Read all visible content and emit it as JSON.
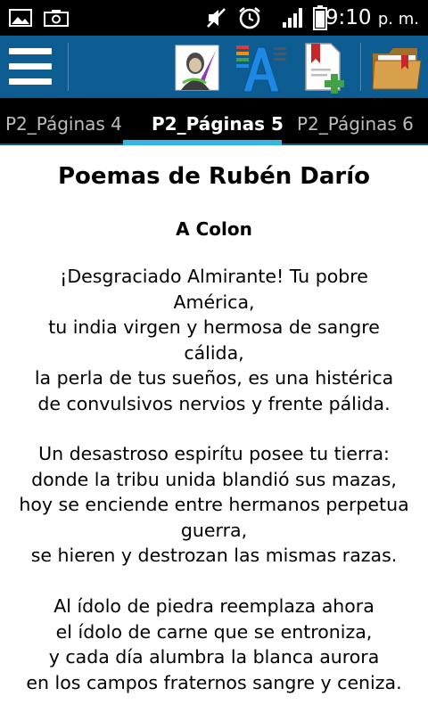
{
  "status_bar": {
    "time": "9:10",
    "ampm": "p. m.",
    "icons": [
      "image-icon",
      "camera-icon",
      "mute-icon",
      "alarm-icon",
      "signal-icon",
      "battery-icon"
    ]
  },
  "toolbar": {
    "icons": [
      "menu-icon",
      "poet-portrait-icon",
      "font-size-icon",
      "add-bookmark-icon",
      "bookmarks-folder-icon"
    ]
  },
  "tabs": [
    {
      "label": "P2_Páginas 4"
    },
    {
      "label": "P2_Páginas 5"
    },
    {
      "label": "P2_Páginas 6"
    }
  ],
  "colors": {
    "toolbar": "#0d5d93",
    "indicator": "#33b5e5",
    "tabbar": "#000000"
  },
  "content": {
    "title": "Poemas de Rubén Darío",
    "subtitle": "A Colon",
    "stanzas": [
      [
        "¡Desgraciado Almirante! Tu pobre",
        "América,",
        "tu india virgen y hermosa de sangre",
        "cálida,",
        "la perla de tus sueños, es una histérica",
        "de convulsivos nervios y frente pálida."
      ],
      [
        "Un desastroso espirítu posee tu tierra:",
        "donde la tribu unida blandió sus mazas,",
        "hoy se enciende entre hermanos perpetua",
        "guerra,",
        "se hieren y destrozan las mismas razas."
      ],
      [
        "Al ídolo de piedra reemplaza ahora",
        "el ídolo de carne que se entroniza,",
        "y cada día alumbra la blanca aurora",
        "en los campos fraternos sangre y ceniza."
      ]
    ]
  }
}
